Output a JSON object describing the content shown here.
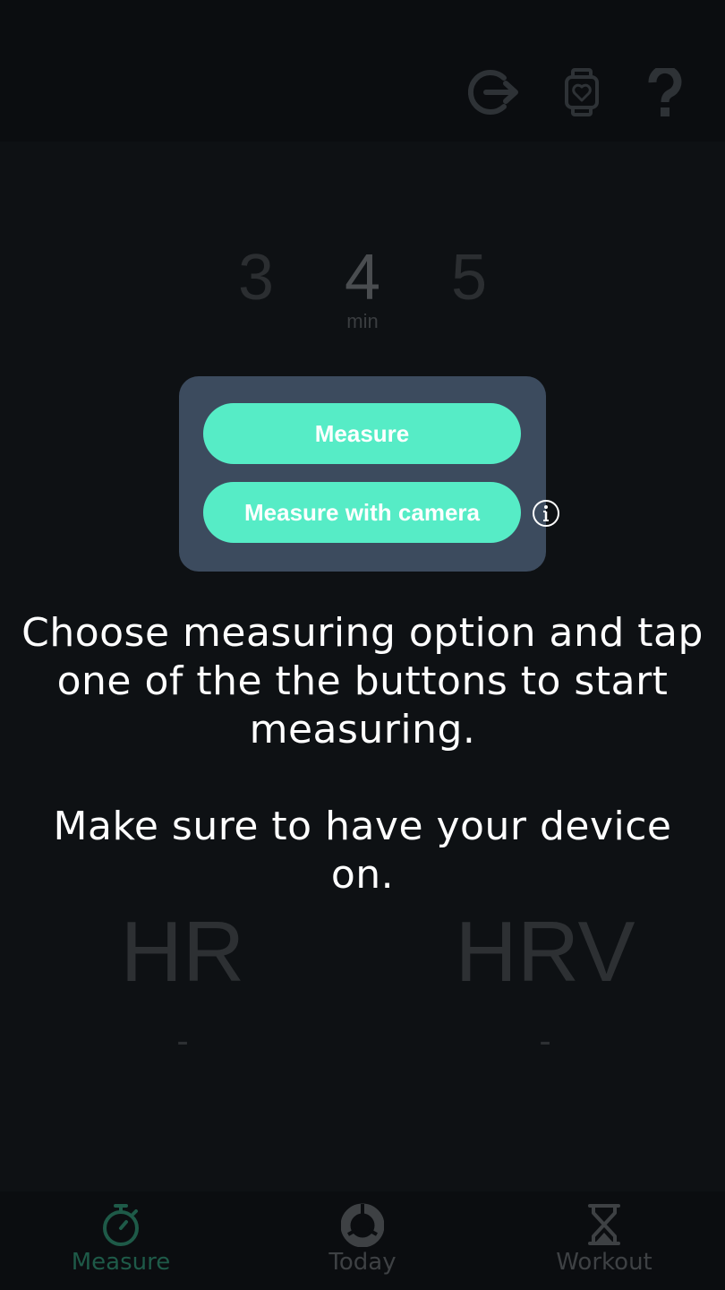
{
  "topbar": {
    "icons": [
      "logout-icon",
      "watch-heart-icon",
      "help-icon"
    ]
  },
  "picker": {
    "options": [
      "3",
      "4",
      "5"
    ],
    "selected": "4",
    "unit": "min"
  },
  "dialog": {
    "measure_label": "Measure",
    "camera_label": "Measure with camera",
    "info_icon": "info-icon"
  },
  "instructions": {
    "line1": "Choose measuring option and tap one of the the buttons to start measuring.",
    "line2": "Make sure to have your device on."
  },
  "metrics": {
    "hr_label": "HR",
    "hr_value": "-",
    "hrv_label": "HRV",
    "hrv_value": "-"
  },
  "bottomnav": {
    "items": [
      {
        "label": "Measure",
        "icon": "stopwatch-icon",
        "active": true
      },
      {
        "label": "Today",
        "icon": "donut-icon",
        "active": false
      },
      {
        "label": "Workout",
        "icon": "hourglass-icon",
        "active": false
      }
    ]
  },
  "colors": {
    "accent": "#56ecc6",
    "dialog_bg": "#3c4b5e",
    "background": "#0e1114",
    "nav_active": "#1e5a48"
  }
}
